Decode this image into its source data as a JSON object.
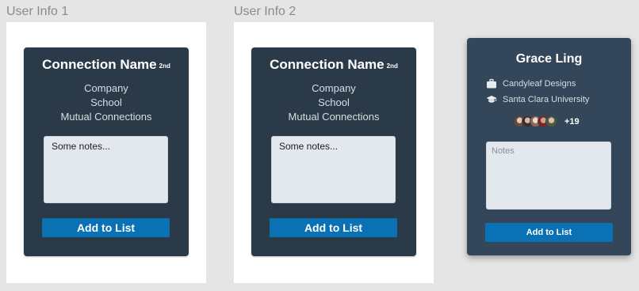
{
  "frames": [
    {
      "label": "User Info 1",
      "card": {
        "name": "Connection Name",
        "degree": "2nd",
        "company": "Company",
        "school": "School",
        "mutual": "Mutual Connections",
        "notes_value": "Some notes...",
        "button_label": "Add to List"
      }
    },
    {
      "label": "User Info 2",
      "card": {
        "name": "Connection Name",
        "degree": "2nd",
        "company": "Company",
        "school": "School",
        "mutual": "Mutual Connections",
        "notes_value": "Some notes...",
        "button_label": "Add to List"
      }
    }
  ],
  "profile_card": {
    "name": "Grace Ling",
    "company": "Candyleaf Designs",
    "company_icon": "briefcase-icon",
    "school": "Santa Clara University",
    "school_icon": "graduation-cap-icon",
    "mutual_more": "+19",
    "notes_placeholder": "Notes",
    "button_label": "Add to List"
  },
  "colors": {
    "canvas_bg": "#e5e5e5",
    "card_bg": "#2b3a48",
    "profile_card_bg": "#33465a",
    "notes_bg": "#e3e8ee",
    "button_bg": "#0a72b4"
  }
}
